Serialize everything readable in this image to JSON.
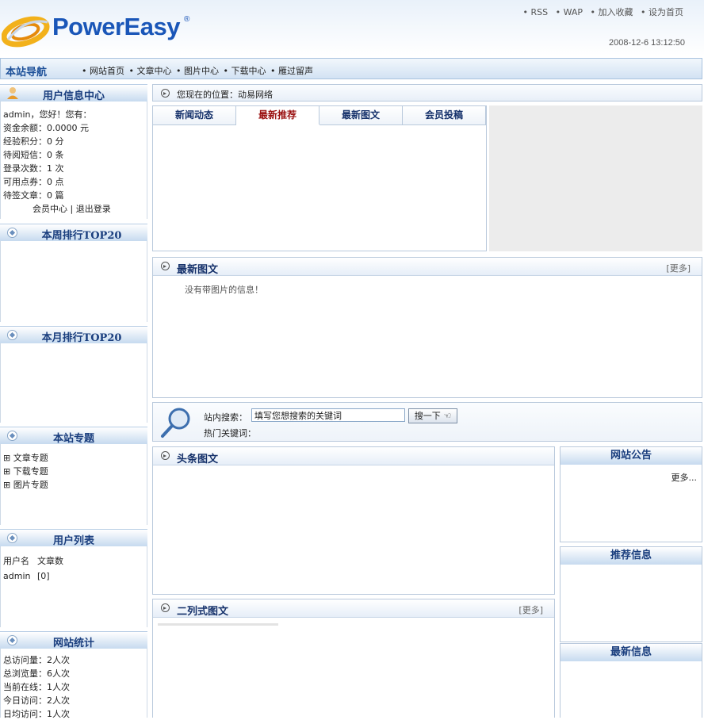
{
  "header": {
    "logo_text": "PowerEasy",
    "logo_mark": "®",
    "top_links": [
      "• RSS",
      "• WAP",
      "• 加入收藏",
      "• 设为首页"
    ],
    "datetime": "2008-12-6 13:12:50"
  },
  "nav": {
    "title": "本站导航",
    "links": [
      "• 网站首页",
      "• 文章中心",
      "• 图片中心",
      "• 下载中心",
      "• 雁过留声"
    ]
  },
  "sidebar": {
    "user_info": {
      "title": "用户信息中心",
      "lines": [
        "admin，您好！您有：",
        "资金余额：0.0000 元",
        "经验积分：0 分",
        "待阅短信：0 条",
        "登录次数：1 次",
        "可用点券：0 点",
        "待签文章：0 篇"
      ],
      "member_center": "会员中心",
      "separator": "|",
      "logout": "退出登录"
    },
    "week_top": {
      "title": "本周排行TOP20"
    },
    "month_top": {
      "title": "本月排行TOP20"
    },
    "specials": {
      "title": "本站专题",
      "items": [
        "文章专题",
        "下载专题",
        "图片专题"
      ]
    },
    "user_list": {
      "title": "用户列表",
      "col_user": "用户名",
      "col_count": "文章数",
      "rows": [
        {
          "name": "admin",
          "count": "[0]"
        }
      ]
    },
    "stats": {
      "title": "网站统计",
      "lines": [
        "总访问量：2人次",
        "总浏览量：6人次",
        "当前在线：1人次",
        "今日访问：2人次",
        "日均访问：1人次"
      ]
    }
  },
  "main": {
    "location": "您现在的位置：动易网络",
    "tabs": [
      "新闻动态",
      "最新推荐",
      "最新图文",
      "会员投稿"
    ],
    "active_tab": 1,
    "latest_pic": {
      "title": "最新图文",
      "more": "[更多]",
      "empty": "没有带图片的信息！"
    },
    "search": {
      "label": "站内搜索：",
      "placeholder": "填写您想搜索的关键词",
      "button": "搜一下",
      "hot_label": "热门关键词："
    },
    "headline_pic": {
      "title": "头条图文"
    },
    "two_col_pic": {
      "title": "二列式图文",
      "more": "[更多]"
    }
  },
  "right": {
    "notice": {
      "title": "网站公告",
      "more": "更多..."
    },
    "recommend": {
      "title": "推荐信息"
    },
    "latest": {
      "title": "最新信息"
    }
  },
  "colors": {
    "accent": "#1a56b8",
    "active_tab": "#9a1010",
    "header_bg": "#c6daef"
  }
}
